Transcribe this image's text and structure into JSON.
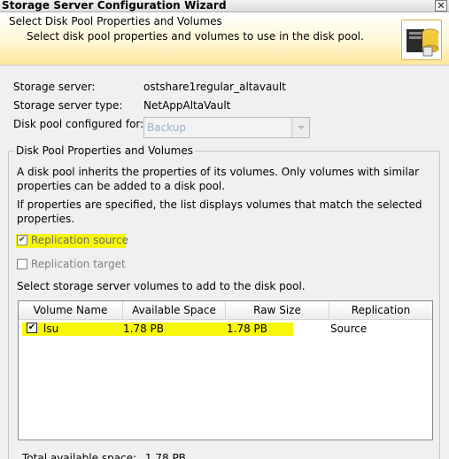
{
  "window": {
    "title": "Storage Server Configuration Wizard",
    "close_glyph": "✕"
  },
  "banner": {
    "title": "Select Disk Pool Properties and Volumes",
    "subtitle": "Select disk pool properties and volumes to use in the disk pool.",
    "icon": "storage-pool-icon"
  },
  "fields": {
    "storage_server_label": "Storage server:",
    "storage_server_value": "ostshare1regular_altavault",
    "storage_server_type_label": "Storage server type:",
    "storage_server_type_value": "NetAppAltaVault",
    "disk_pool_for_label": "Disk pool configured for:",
    "disk_pool_for_value": "Backup"
  },
  "group": {
    "title": "Disk Pool Properties and Volumes",
    "para1": "A disk pool inherits the properties of its volumes. Only volumes with similar properties can be added to a disk pool.",
    "para2": "If properties are specified, the list displays volumes that match the selected properties.",
    "replication_source_label": "Replication source",
    "replication_source_checked": true,
    "replication_target_label": "Replication target",
    "replication_target_checked": false,
    "select_text": "Select storage server volumes to add to the disk pool."
  },
  "table": {
    "columns": [
      "Volume Name",
      "Available Space",
      "Raw Size",
      "Replication"
    ],
    "rows": [
      {
        "checked": true,
        "volume_name": "lsu",
        "available_space": "1.78 PB",
        "raw_size": "1.78 PB",
        "replication": "Source"
      }
    ]
  },
  "footer": {
    "total_available_label": "Total available space:",
    "total_available_value": "1.78 PB"
  },
  "colors": {
    "highlight": "#f7f70a",
    "banner_gradient_end": "#fde79b"
  }
}
